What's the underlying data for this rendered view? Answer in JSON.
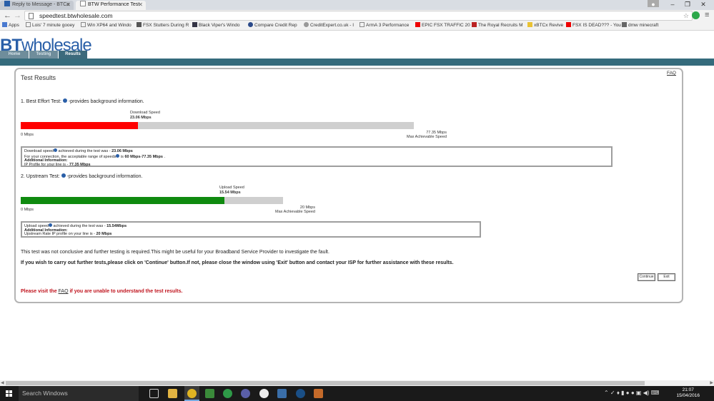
{
  "browser": {
    "tabs": [
      {
        "label": "Reply to Message - BTCa",
        "active": false
      },
      {
        "label": "BTW Performance Test",
        "active": true
      }
    ],
    "url": "speedtest.btwholesale.com",
    "bookmarks": [
      "Apps",
      "Lois' 7 minute gooey",
      "Win XP64 and Windo",
      "FSX Stutters During R",
      "Black Viper's Windo",
      "Compare Credit Rep",
      "CreditExpert.co.uk - I",
      "ArmA 3 Performance",
      "EPIC FSX TRAFFIC 20",
      "The Royal Recruits M",
      "xBTCx Revive",
      "FSX IS DEAD??? - You",
      "dmw minecraft"
    ]
  },
  "site": {
    "logo_bold": "BT",
    "logo_rest": "wholesale",
    "nav_tabs": [
      "Home",
      "Testing",
      "Results"
    ],
    "active_tab": "Results"
  },
  "results": {
    "title": "Test Results",
    "faq": "FAQ",
    "best_effort": {
      "heading": "1. Best Effort Test:",
      "heading_suffix": "-provides background information.",
      "speed_caption": "Download Speed",
      "speed_value": "23.06 Mbps",
      "min_label": "0 Mbps",
      "max_value": "77.35 Mbps",
      "max_caption": "Max Achievable Speed",
      "measured": 23.06,
      "maximum": 77.35,
      "bar_color": "#ff0000",
      "info_line1_a": "Download speed",
      "info_line1_b": " achieved during the test was - ",
      "info_line1_val": "23.06 Mbps",
      "info_line2_a": "For your connection, the acceptable range of speeds",
      "info_line2_b": " is ",
      "info_line2_val": "60 Mbps-77.35 Mbps",
      "info_line2_end": " .",
      "info_line3": "Additional Information:",
      "info_line4_a": "IP Profile for your line is - ",
      "info_line4_val": "77.35 Mbps"
    },
    "upstream": {
      "heading": "2. Upstream Test:",
      "heading_suffix": "-provides background information.",
      "speed_caption": "Upload Speed",
      "speed_value": "15.54 Mbps",
      "min_label": "0 Mbps",
      "max_value": "20 Mbps",
      "max_caption": "Max Achievable Speed",
      "measured": 15.54,
      "maximum": 20,
      "bar_color": "#0f8a0f",
      "info_line1_a": "Upload speed",
      "info_line1_b": " achieved during the test was - ",
      "info_line1_val": "15.54Mbps",
      "info_line2": "Additional Information:",
      "info_line3_a": "Upstream Rate IP profile on your line is - ",
      "info_line3_val": "20 Mbps"
    },
    "inconclusive_note": "This test was not conclusive and further testing is required.This might be useful for your Broadband Service Provider to investigate the fault.",
    "instruction_note": "If you wish to carry out further tests,please click on 'Continue' button.If not, please close the window using 'Exit' button and contact your ISP for further assistance with these results.",
    "continue_label": "Continue",
    "exit_label": "Exit",
    "visit_before": "Please visit the ",
    "visit_link": "FAQ",
    "visit_after": " if you are unable to understand the test results."
  },
  "taskbar": {
    "search_placeholder": "Search Windows",
    "time": "21:07",
    "date": "15/04/2016"
  }
}
